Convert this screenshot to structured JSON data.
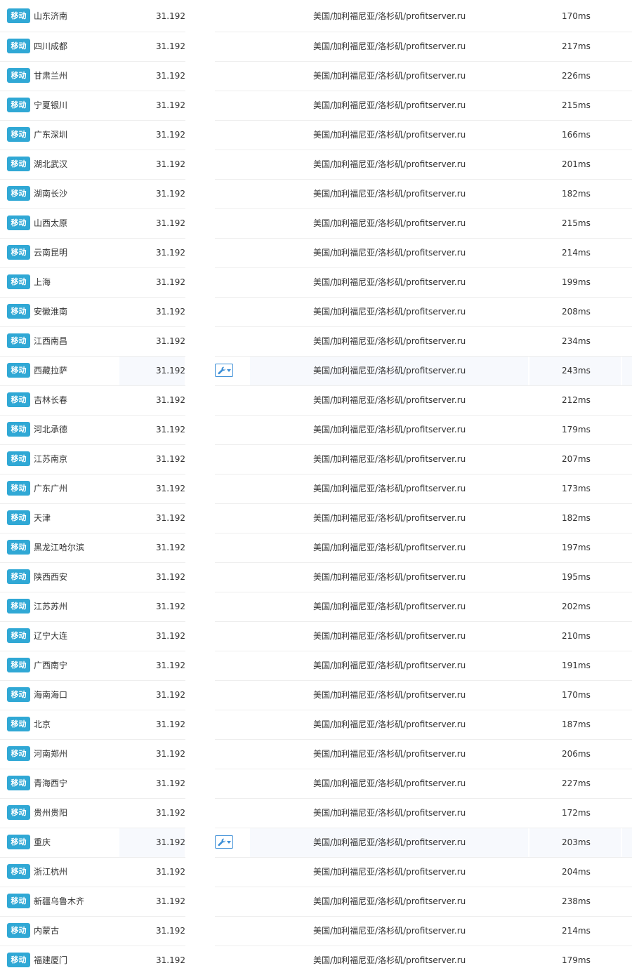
{
  "isp_label": "移动",
  "ip_prefix": "31.192.",
  "location": "美国/加利福尼亚/洛杉矶/profitserver.ru",
  "tool_icon": "wrench-dropdown-icon",
  "colors": {
    "badge": "#30a8d5",
    "tool_border": "#3d8fd7",
    "hover_row": "#f7f9fd",
    "text": "#333333"
  },
  "rows": [
    {
      "city": "山东济南",
      "latency": "170ms"
    },
    {
      "city": "四川成都",
      "latency": "217ms"
    },
    {
      "city": "甘肃兰州",
      "latency": "226ms"
    },
    {
      "city": "宁夏银川",
      "latency": "215ms"
    },
    {
      "city": "广东深圳",
      "latency": "166ms"
    },
    {
      "city": "湖北武汉",
      "latency": "201ms"
    },
    {
      "city": "湖南长沙",
      "latency": "182ms"
    },
    {
      "city": "山西太原",
      "latency": "215ms"
    },
    {
      "city": "云南昆明",
      "latency": "214ms"
    },
    {
      "city": "上海",
      "latency": "199ms"
    },
    {
      "city": "安徽淮南",
      "latency": "208ms"
    },
    {
      "city": "江西南昌",
      "latency": "234ms"
    },
    {
      "city": "西藏拉萨",
      "latency": "243ms",
      "hover": true
    },
    {
      "city": "吉林长春",
      "latency": "212ms"
    },
    {
      "city": "河北承德",
      "latency": "179ms"
    },
    {
      "city": "江苏南京",
      "latency": "207ms"
    },
    {
      "city": "广东广州",
      "latency": "173ms"
    },
    {
      "city": "天津",
      "latency": "182ms"
    },
    {
      "city": "黑龙江哈尔滨",
      "latency": "197ms"
    },
    {
      "city": "陕西西安",
      "latency": "195ms"
    },
    {
      "city": "江苏苏州",
      "latency": "202ms"
    },
    {
      "city": "辽宁大连",
      "latency": "210ms"
    },
    {
      "city": "广西南宁",
      "latency": "191ms"
    },
    {
      "city": "海南海口",
      "latency": "170ms"
    },
    {
      "city": "北京",
      "latency": "187ms"
    },
    {
      "city": "河南郑州",
      "latency": "206ms"
    },
    {
      "city": "青海西宁",
      "latency": "227ms"
    },
    {
      "city": "贵州贵阳",
      "latency": "172ms"
    },
    {
      "city": "重庆",
      "latency": "203ms",
      "hover": true
    },
    {
      "city": "浙江杭州",
      "latency": "204ms"
    },
    {
      "city": "新疆乌鲁木齐",
      "latency": "238ms"
    },
    {
      "city": "内蒙古",
      "latency": "214ms"
    },
    {
      "city": "福建厦门",
      "latency": "179ms"
    }
  ]
}
